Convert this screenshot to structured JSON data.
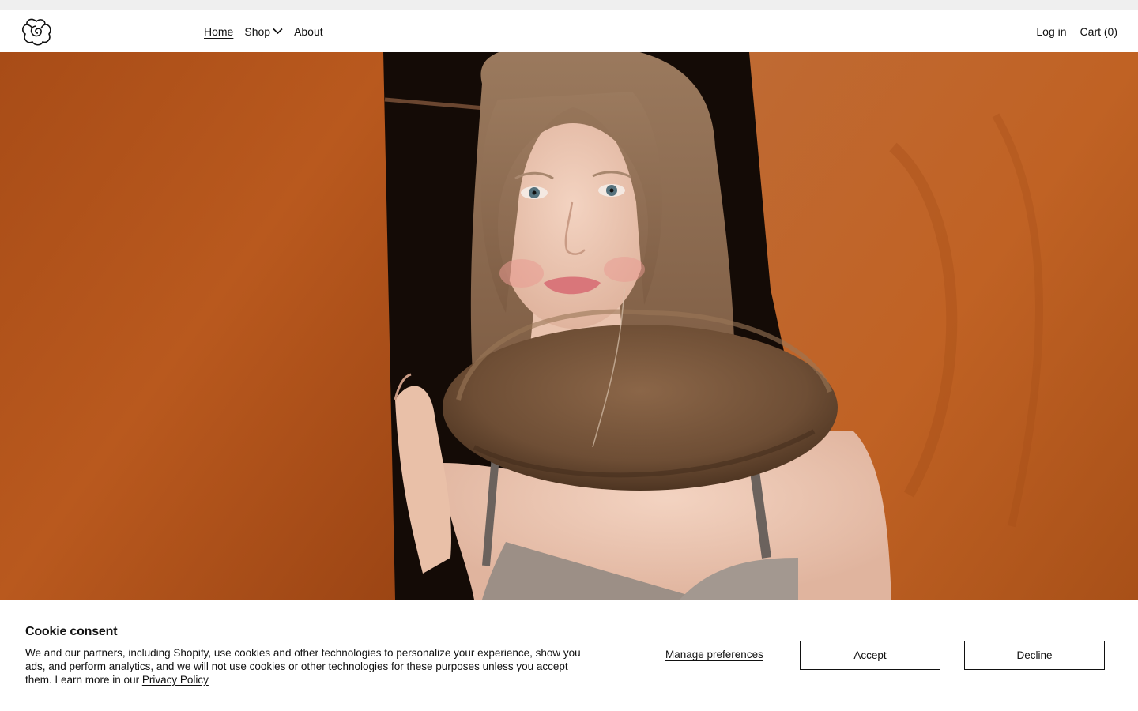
{
  "header": {
    "logo_icon": "flower-swirl-logo-icon",
    "nav": [
      {
        "label": "Home",
        "active": true
      },
      {
        "label": "Shop",
        "has_dropdown": true,
        "icon": "chevron-down-icon"
      },
      {
        "label": "About"
      }
    ],
    "login_label": "Log in",
    "cart_label": "Cart (0)"
  },
  "hero": {
    "image_subject": "portrait-photo",
    "colors": {
      "wood": "#b6571d",
      "shadow": "#120a06"
    }
  },
  "cookie_banner": {
    "title": "Cookie consent",
    "text": "We and our partners, including Shopify, use cookies and other technologies to personalize your experience, show you ads, and perform analytics, and we will not use cookies or other technologies for these purposes unless you accept them. Learn more in our ",
    "privacy_link": "Privacy Policy",
    "manage_label": "Manage preferences",
    "accept_label": "Accept",
    "decline_label": "Decline"
  }
}
